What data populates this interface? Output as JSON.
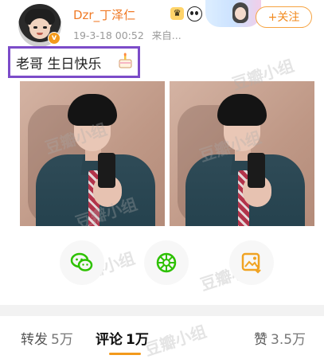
{
  "header": {
    "username": "Dzr_丁泽仁",
    "timestamp": "19-3-18 00:52",
    "source": "来自...",
    "follow_label": "+关注",
    "verified_badge": "v"
  },
  "post": {
    "text": "老哥 生日快乐",
    "emoji": "cake-emoji"
  },
  "watermark": "豆瓣小组",
  "share": {
    "items": [
      "wechat-icon",
      "moments-icon",
      "save-image-icon"
    ]
  },
  "tabs": [
    {
      "label": "转发",
      "count": "5万"
    },
    {
      "label": "评论",
      "count": "1万"
    },
    {
      "label": "赞",
      "count": "3.5万"
    }
  ],
  "colors": {
    "accent": "#f39a1c",
    "username": "#f07a26",
    "highlight_box": "#7c4cc9",
    "wechat_green": "#2dc100"
  }
}
